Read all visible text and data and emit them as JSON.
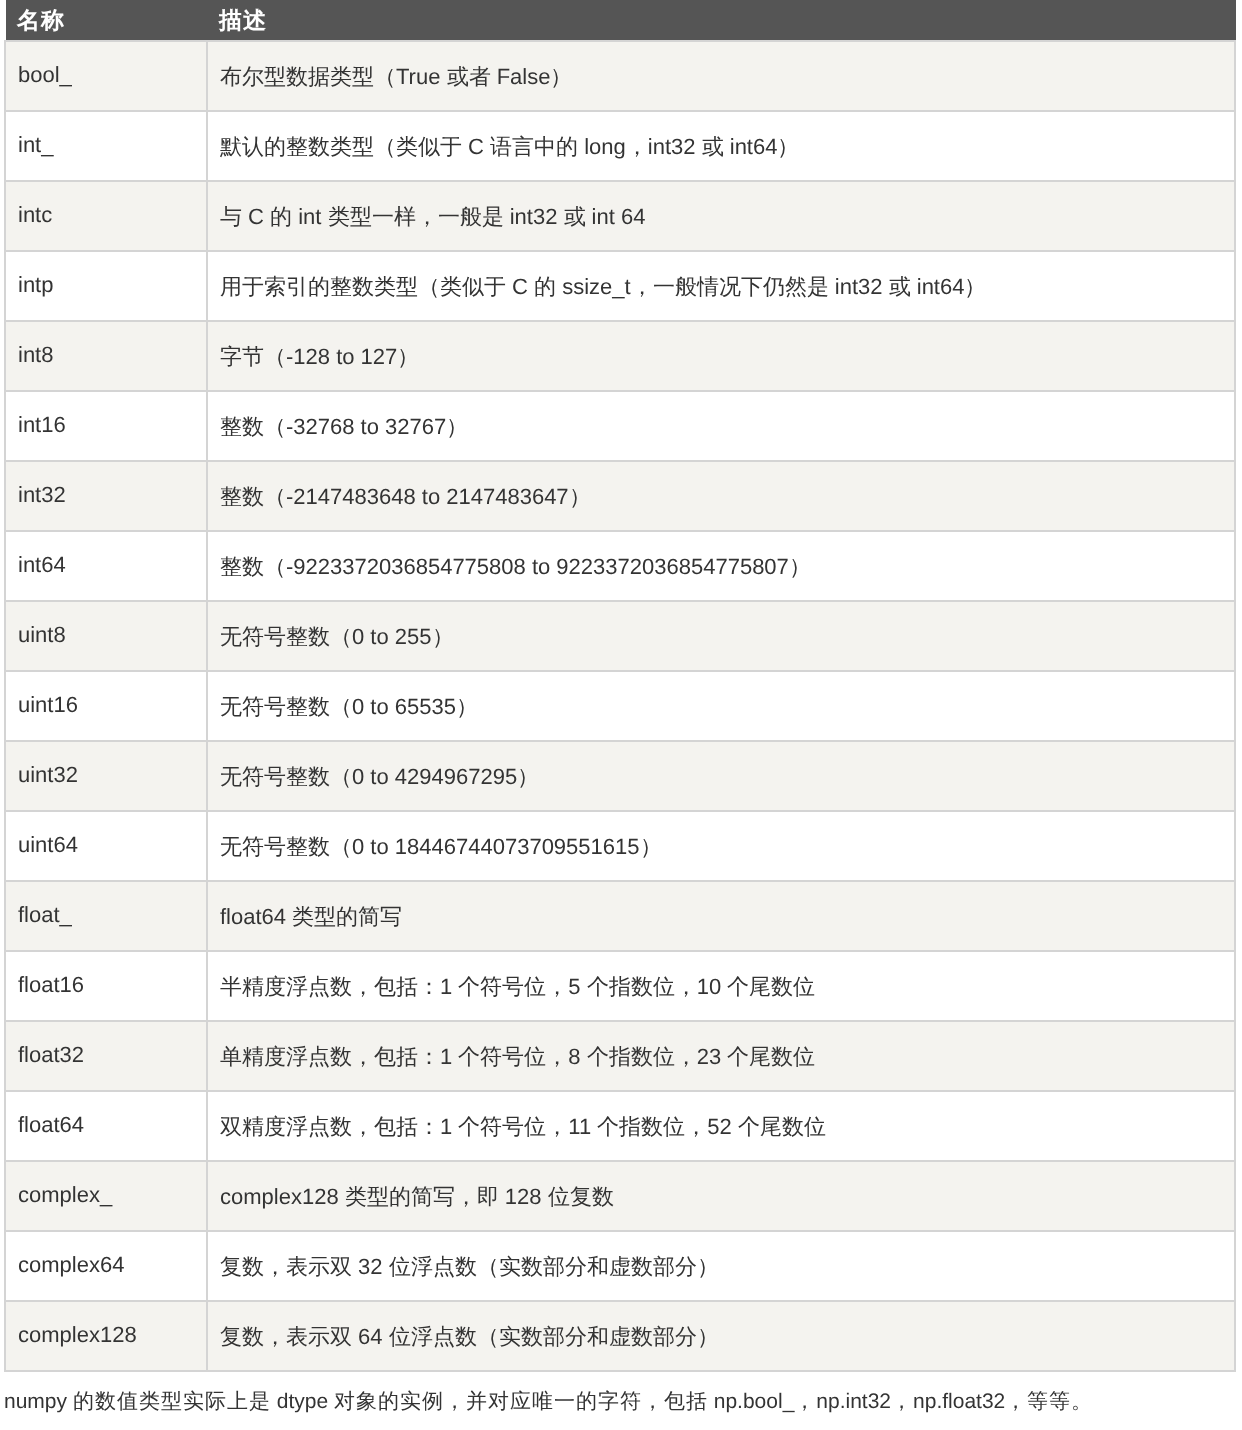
{
  "table": {
    "columns": [
      "名称",
      "描述"
    ],
    "rows": [
      {
        "name": "bool_",
        "description": "布尔型数据类型（True 或者 False）"
      },
      {
        "name": "int_",
        "description": "默认的整数类型（类似于 C 语言中的 long，int32 或 int64）"
      },
      {
        "name": "intc",
        "description": "与 C 的 int 类型一样，一般是 int32 或 int 64"
      },
      {
        "name": "intp",
        "description": "用于索引的整数类型（类似于 C 的 ssize_t，一般情况下仍然是 int32 或 int64）"
      },
      {
        "name": "int8",
        "description": "字节（-128 to 127）"
      },
      {
        "name": "int16",
        "description": "整数（-32768 to 32767）"
      },
      {
        "name": "int32",
        "description": "整数（-2147483648 to 2147483647）"
      },
      {
        "name": "int64",
        "description": "整数（-9223372036854775808 to 9223372036854775807）"
      },
      {
        "name": "uint8",
        "description": "无符号整数（0 to 255）"
      },
      {
        "name": "uint16",
        "description": "无符号整数（0 to 65535）"
      },
      {
        "name": "uint32",
        "description": "无符号整数（0 to 4294967295）"
      },
      {
        "name": "uint64",
        "description": "无符号整数（0 to 18446744073709551615）"
      },
      {
        "name": "float_",
        "description": "float64 类型的简写"
      },
      {
        "name": "float16",
        "description": "半精度浮点数，包括：1 个符号位，5 个指数位，10 个尾数位"
      },
      {
        "name": "float32",
        "description": "单精度浮点数，包括：1 个符号位，8 个指数位，23 个尾数位"
      },
      {
        "name": "float64",
        "description": "双精度浮点数，包括：1 个符号位，11 个指数位，52 个尾数位"
      },
      {
        "name": "complex_",
        "description": "complex128 类型的简写，即 128 位复数"
      },
      {
        "name": "complex64",
        "description": "复数，表示双 32 位浮点数（实数部分和虚数部分）"
      },
      {
        "name": "complex128",
        "description": "复数，表示双 64 位浮点数（实数部分和虚数部分）"
      }
    ]
  },
  "note": "numpy 的数值类型实际上是 dtype 对象的实例，并对应唯一的字符，包括 np.bool_，np.int32，np.float32，等等。"
}
